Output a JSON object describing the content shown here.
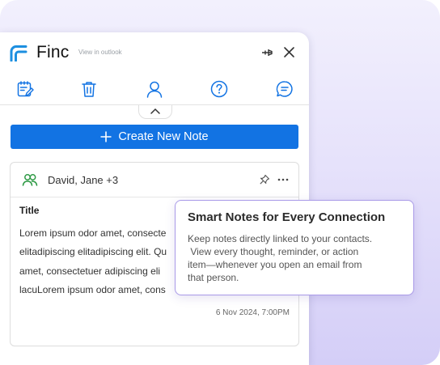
{
  "header": {
    "app_name": "Finc",
    "view_link": "View in outlook",
    "icons": [
      "logo-icon",
      "pin-icon",
      "close-icon"
    ]
  },
  "toolbar": {
    "icons": [
      "calendar-notes-icon",
      "trash-icon",
      "user-icon",
      "help-icon",
      "chat-icon"
    ]
  },
  "actions": {
    "create_note_label": "Create New Note"
  },
  "note": {
    "contacts": "David, Jane +3",
    "title": "Title",
    "body_lines": [
      "Lorem ipsum odor amet, consecte",
      "elitadipiscing elitadipiscing elit. Qu",
      "amet, consectetuer adipiscing eli",
      "lacuLorem ipsum odor amet, cons"
    ],
    "date": "6 Nov 2024, 7:00PM"
  },
  "tooltip": {
    "title": "Smart Notes for Every Connection",
    "lines": [
      "Keep notes directly linked to your contacts.",
      " View every thought, reminder, or action",
      "item—whenever you open an email from",
      "that person."
    ]
  },
  "colors": {
    "accent": "#1273e3",
    "contacts_green": "#2e9a45",
    "tooltip_border": "#a99ae8",
    "backdrop": "#e6e2fb"
  }
}
